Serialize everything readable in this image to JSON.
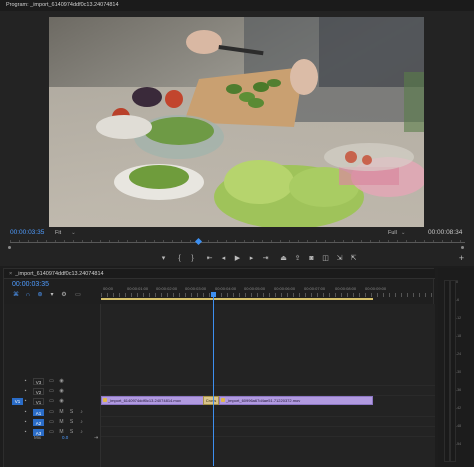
{
  "program_monitor": {
    "title": "Program: _import_6140974ddf0c13.24074814",
    "timecode_current": "00:00:03:35",
    "fit_label": "Fit",
    "resolution_label": "Full",
    "timecode_duration": "00:00:08:34",
    "transport_icons": [
      "marker-icon",
      "mark-in-icon",
      "mark-out-icon",
      "go-to-in-icon",
      "step-back-icon",
      "play-icon",
      "step-forward-icon",
      "go-to-out-icon",
      "lift-icon",
      "extract-icon",
      "export-frame-icon",
      "comparison-view-icon",
      "insert-icon",
      "overwrite-icon",
      "add-button-icon"
    ]
  },
  "timeline": {
    "title": "_import_6140974ddf0c13.24074814",
    "timecode": "00:00:03:35",
    "ruler_labels": [
      "00:00",
      "00:00:01:00",
      "00:00:02:00",
      "00:00:03:00",
      "00:00:04:00",
      "00:00:05:00",
      "00:00:06:00",
      "00:00:07:00",
      "00:00:08:00",
      "00:00:09:00"
    ],
    "tracks": [
      {
        "name": "V3",
        "type": "video"
      },
      {
        "name": "V2",
        "type": "video"
      },
      {
        "name": "V1",
        "type": "video",
        "source": "V1"
      },
      {
        "name": "A1",
        "type": "audio"
      },
      {
        "name": "A2",
        "type": "audio"
      },
      {
        "name": "A3",
        "type": "audio"
      }
    ],
    "mix_label": "Mix",
    "mix_value": "0.0",
    "clips": [
      {
        "name": "_import_6140974ddf0c13.24074814.mov"
      },
      {
        "name": "_import_60996a67d4ae51.71220372.mov"
      }
    ],
    "transition_label": "Cross Dis"
  },
  "meter": {
    "db_labels": [
      "0",
      "-6",
      "-12",
      "-18",
      "-24",
      "-30",
      "-36",
      "-42",
      "-48",
      "-54"
    ]
  },
  "colors": {
    "accent": "#3d8ff0",
    "clip": "#b19ae0",
    "work_area": "#d5c06a"
  }
}
